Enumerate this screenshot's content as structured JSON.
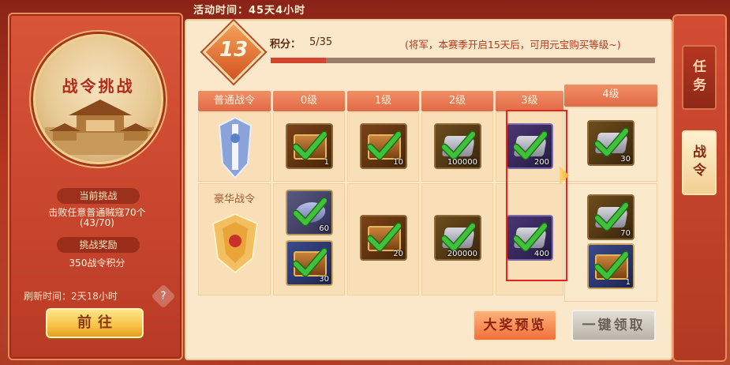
{
  "header": {
    "activity_time": "活动时间：45天4小时"
  },
  "left": {
    "title": "战令挑战",
    "current_challenge_label": "当前挑战",
    "challenge_desc": "击败任意普通贼寇70个",
    "challenge_progress": "(43/70)",
    "reward_label": "挑战奖励",
    "reward_value": "350战令积分",
    "refresh_text": "刷新时间：2天18小时",
    "help": "?",
    "go_button": "前往"
  },
  "main": {
    "level": "13",
    "score_label": "积分：",
    "score_value": "5/35",
    "score_progress_fraction": 0.143,
    "note": "(将军，本赛季开启15天后，可用元宝购买等级~)",
    "row_labels": {
      "normal": "普通战令",
      "deluxe": "豪华战令"
    },
    "columns": [
      "0级",
      "1级",
      "2级",
      "3级",
      "4级"
    ],
    "normal_rewards": [
      {
        "kind": "chest",
        "qty": "1"
      },
      {
        "kind": "chest",
        "qty": "10"
      },
      {
        "kind": "silver-gold",
        "qty": "100000"
      },
      {
        "kind": "silver",
        "qty": "200"
      },
      {
        "kind": "silver-gold",
        "qty": "30"
      }
    ],
    "deluxe_rewards": [
      [
        {
          "kind": "hero",
          "qty": "60"
        },
        {
          "kind": "chest-blue",
          "qty": "30"
        }
      ],
      [
        {
          "kind": "chest",
          "qty": "20"
        }
      ],
      [
        {
          "kind": "silver-gold",
          "qty": "200000"
        }
      ],
      [
        {
          "kind": "silver",
          "qty": "400"
        }
      ],
      [
        {
          "kind": "silver-gold",
          "qty": "70"
        },
        {
          "kind": "chest-blue",
          "qty": "1"
        }
      ]
    ],
    "preview_button": "大奖预览",
    "claim_all_button": "一键领取"
  },
  "tabs": {
    "task": "任务",
    "pass": "战令"
  },
  "colors": {
    "accent_red": "#d3452c",
    "highlight": "#e8221c",
    "check_green": "#3ec23a"
  }
}
